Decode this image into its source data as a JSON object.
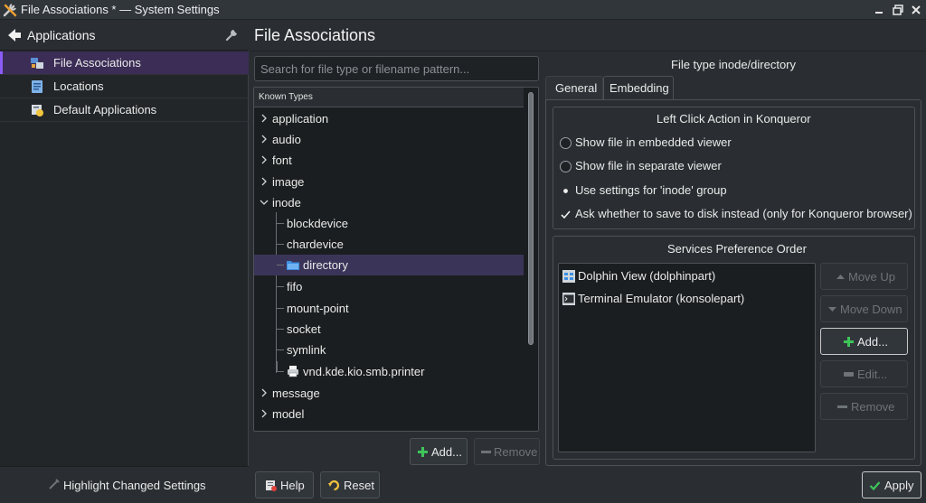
{
  "window": {
    "title": "File Associations * — System Settings"
  },
  "sidebar": {
    "header_label": "Applications",
    "items": [
      {
        "label": "File Associations",
        "selected": true
      },
      {
        "label": "Locations",
        "selected": false
      },
      {
        "label": "Default Applications",
        "selected": false
      }
    ],
    "footer_label": "Highlight Changed Settings"
  },
  "main": {
    "title": "File Associations",
    "search_placeholder": "Search for file type or filename pattern...",
    "tree": {
      "header": "Known Types",
      "rows": [
        {
          "label": "application",
          "expanded": false
        },
        {
          "label": "audio",
          "expanded": false
        },
        {
          "label": "font",
          "expanded": false
        },
        {
          "label": "image",
          "expanded": false
        },
        {
          "label": "inode",
          "expanded": true
        },
        {
          "label": "blockdevice"
        },
        {
          "label": "chardevice"
        },
        {
          "label": "directory",
          "selected": true
        },
        {
          "label": "fifo"
        },
        {
          "label": "mount-point"
        },
        {
          "label": "socket"
        },
        {
          "label": "symlink"
        },
        {
          "label": "vnd.kde.kio.smb.printer"
        },
        {
          "label": "message",
          "expanded": false
        },
        {
          "label": "model",
          "expanded": false
        }
      ]
    },
    "tree_buttons": {
      "add": "Add...",
      "remove": "Remove"
    }
  },
  "details": {
    "file_type_title": "File type inode/directory",
    "tabs": [
      {
        "label": "General",
        "active": false
      },
      {
        "label": "Embedding",
        "active": true
      }
    ],
    "left_click": {
      "title": "Left Click Action in Konqueror",
      "options": [
        {
          "label": "Show file in embedded viewer",
          "state": "radio-off"
        },
        {
          "label": "Show file in separate viewer",
          "state": "radio-off"
        },
        {
          "label": "Use settings for 'inode' group",
          "state": "dot"
        },
        {
          "label": "Ask whether to save to disk instead (only for Konqueror browser)",
          "state": "check"
        }
      ]
    },
    "services": {
      "title": "Services Preference Order",
      "items": [
        {
          "label": "Dolphin View (dolphinpart)"
        },
        {
          "label": "Terminal Emulator (konsolepart)"
        }
      ],
      "buttons": {
        "move_up": "Move Up",
        "move_down": "Move Down",
        "add": "Add...",
        "edit": "Edit...",
        "remove": "Remove"
      }
    }
  },
  "footer": {
    "help": "Help",
    "reset": "Reset",
    "apply": "Apply"
  },
  "colors": {
    "window_bg": "#2a2e32",
    "view_bg": "#1b1e20",
    "selection": "#3b3459",
    "accent": "#8b5cf6",
    "add_green": "#3ec55a"
  }
}
